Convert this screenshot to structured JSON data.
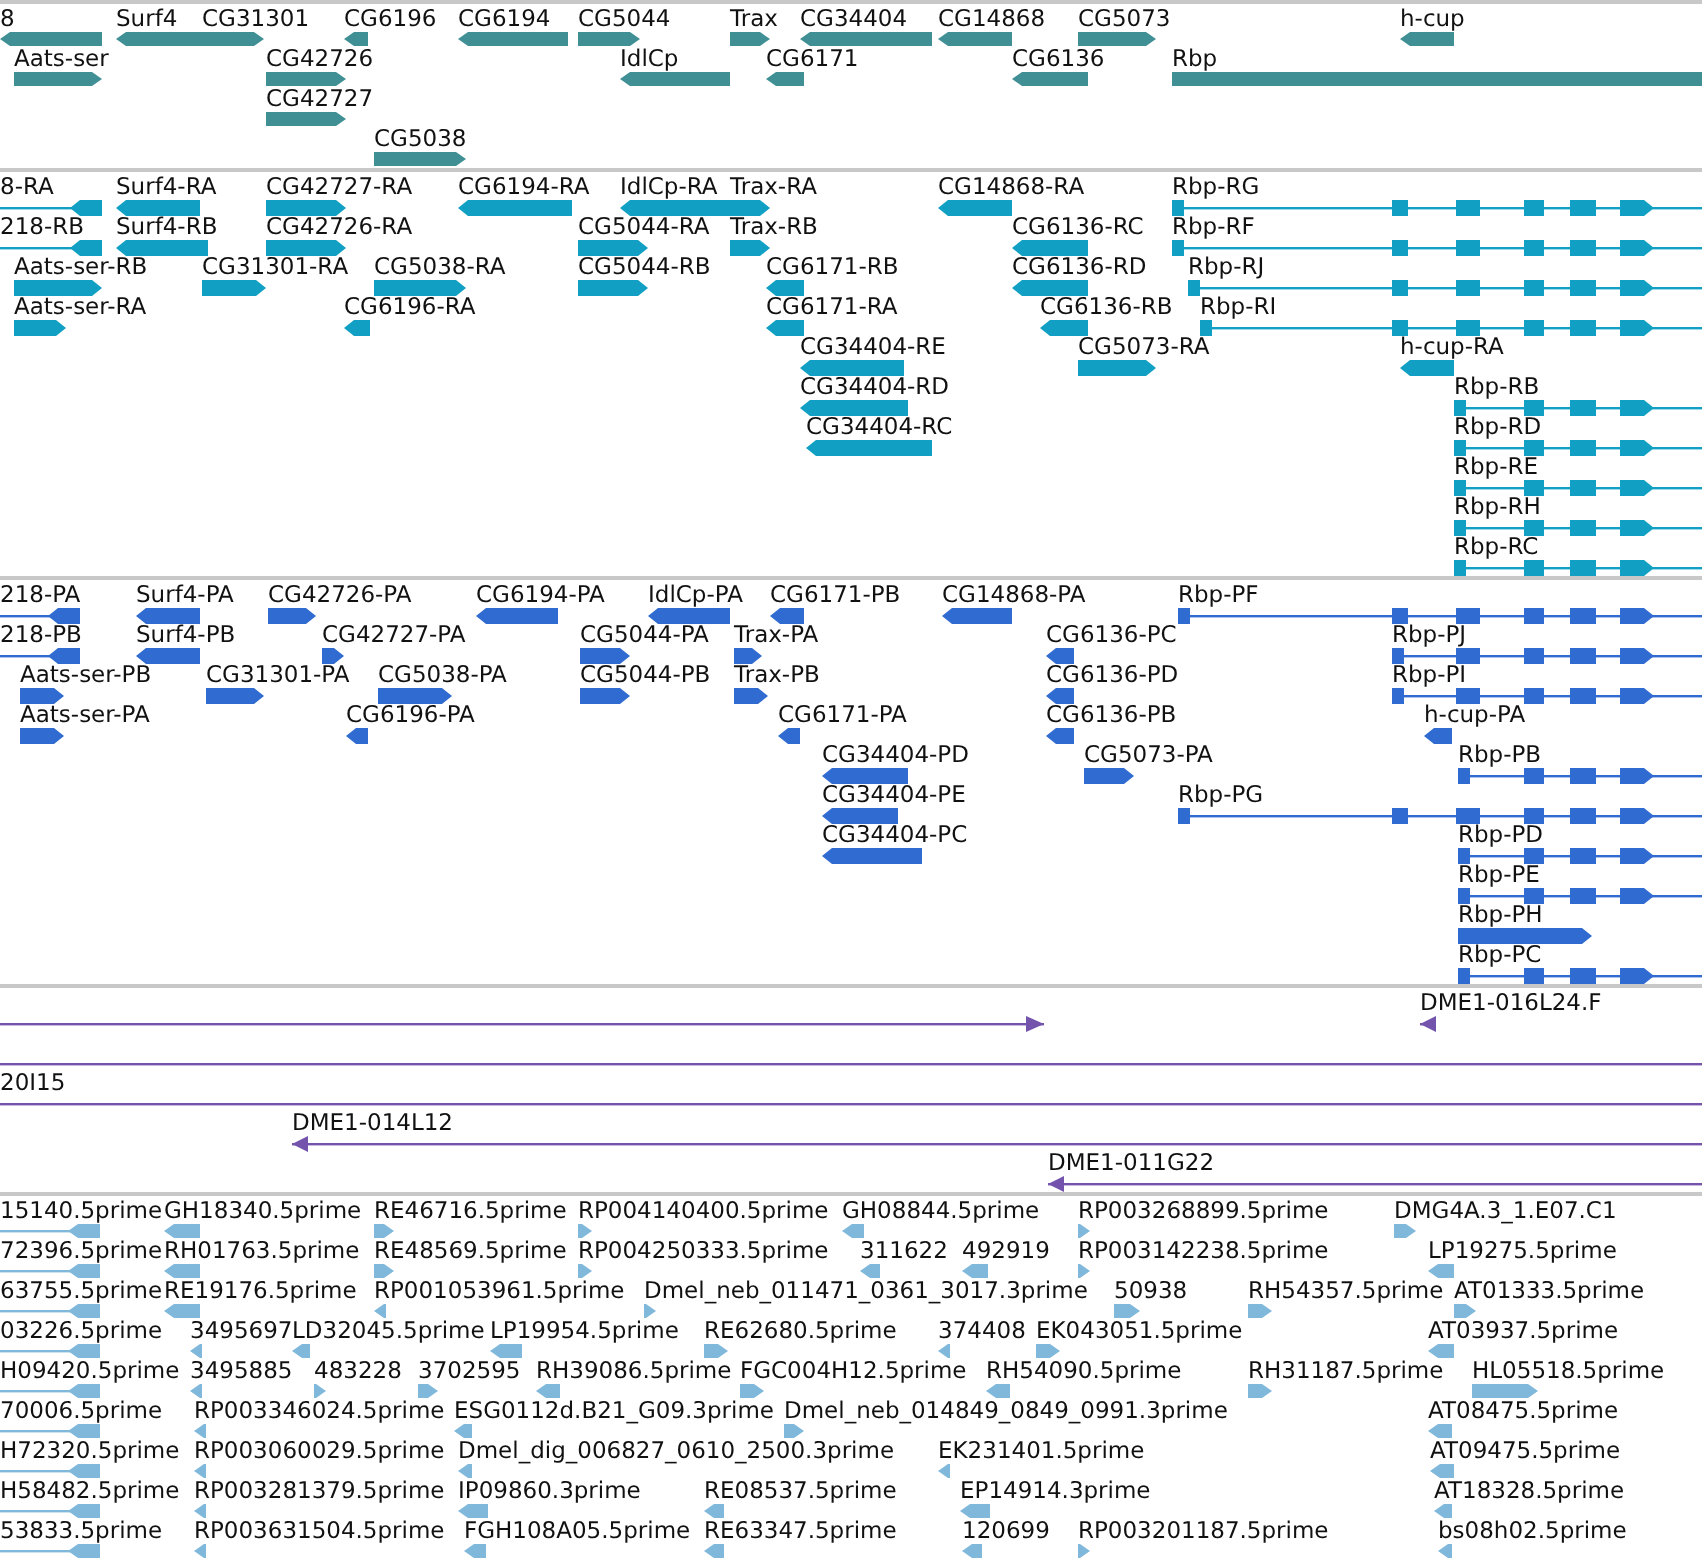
{
  "tracks": [
    {
      "kind": "gene",
      "lanes": [
        {
          "features": [
            {
              "label": "8",
              "kind": "reverse"
            },
            {
              "label": "Surf4",
              "kind": "reverse"
            },
            {
              "label": "CG31301",
              "kind": "forward"
            },
            {
              "label": "CG6196",
              "kind": "reverse"
            },
            {
              "label": "CG6194",
              "kind": "reverse"
            },
            {
              "label": "CG5044",
              "kind": "forward"
            },
            {
              "label": "Trax",
              "kind": "forward"
            },
            {
              "label": "CG34404",
              "kind": "reverse"
            },
            {
              "label": "CG14868",
              "kind": "reverse"
            },
            {
              "label": "CG5073",
              "kind": "forward"
            },
            {
              "label": "h-cup",
              "kind": "reverse"
            }
          ]
        },
        {
          "features": [
            {
              "label": "Aats-ser",
              "kind": "forward"
            },
            {
              "label": "CG42726",
              "kind": "forward"
            },
            {
              "label": "IdlCp",
              "kind": "reverse"
            },
            {
              "label": "CG6171",
              "kind": "reverse"
            },
            {
              "label": "CG6136",
              "kind": "reverse"
            },
            {
              "label": "Rbp"
            }
          ]
        },
        {
          "features": [
            {
              "label": "CG42727",
              "kind": "forward"
            }
          ]
        },
        {
          "features": [
            {
              "label": "CG5038",
              "kind": "forward"
            }
          ]
        }
      ]
    },
    {
      "kind": "transcript",
      "lanes": [
        {
          "features": [
            {
              "label": "8-RA",
              "kind": "reverse"
            },
            {
              "label": "Surf4-RA",
              "kind": "reverse"
            },
            {
              "label": "CG42727-RA",
              "kind": "forward"
            },
            {
              "label": "CG6194-RA",
              "kind": "reverse"
            },
            {
              "label": "IdlCp-RA",
              "kind": "reverse"
            },
            {
              "label": "Trax-RA",
              "kind": "forward"
            },
            {
              "label": "CG14868-RA",
              "kind": "reverse"
            },
            {
              "label": "Rbp-RG",
              "kind": "forward"
            }
          ]
        },
        {
          "features": [
            {
              "label": "218-RB",
              "kind": "reverse"
            },
            {
              "label": "Surf4-RB",
              "kind": "reverse"
            },
            {
              "label": "CG42726-RA",
              "kind": "forward"
            },
            {
              "label": "CG5044-RA",
              "kind": "forward"
            },
            {
              "label": "Trax-RB",
              "kind": "forward"
            },
            {
              "label": "CG6136-RC",
              "kind": "reverse"
            },
            {
              "label": "Rbp-RF",
              "kind": "forward"
            }
          ]
        },
        {
          "features": [
            {
              "label": "Aats-ser-RB",
              "kind": "forward"
            },
            {
              "label": "CG31301-RA",
              "kind": "forward"
            },
            {
              "label": "CG5038-RA",
              "kind": "forward"
            },
            {
              "label": "CG5044-RB",
              "kind": "forward"
            },
            {
              "label": "CG6171-RB",
              "kind": "reverse"
            },
            {
              "label": "CG6136-RD",
              "kind": "reverse"
            },
            {
              "label": "Rbp-RJ",
              "kind": "forward"
            }
          ]
        },
        {
          "features": [
            {
              "label": "Aats-ser-RA",
              "kind": "forward"
            },
            {
              "label": "CG6196-RA",
              "kind": "reverse"
            },
            {
              "label": "CG6171-RA",
              "kind": "reverse"
            },
            {
              "label": "CG6136-RB",
              "kind": "reverse"
            },
            {
              "label": "Rbp-RI",
              "kind": "forward"
            }
          ]
        },
        {
          "features": [
            {
              "label": "CG34404-RE",
              "kind": "reverse"
            },
            {
              "label": "CG5073-RA",
              "kind": "forward"
            },
            {
              "label": "h-cup-RA",
              "kind": "reverse"
            }
          ]
        },
        {
          "features": [
            {
              "label": "CG34404-RD",
              "kind": "reverse"
            },
            {
              "label": "Rbp-RB",
              "kind": "forward"
            }
          ]
        },
        {
          "features": [
            {
              "label": "CG34404-RC",
              "kind": "reverse"
            },
            {
              "label": "Rbp-RD",
              "kind": "forward"
            }
          ]
        },
        {
          "features": [
            {
              "label": "Rbp-RE",
              "kind": "forward"
            }
          ]
        },
        {
          "features": [
            {
              "label": "Rbp-RH",
              "kind": "forward"
            }
          ]
        },
        {
          "features": [
            {
              "label": "Rbp-RC",
              "kind": "forward"
            }
          ]
        }
      ]
    },
    {
      "kind": "protein",
      "lanes": [
        {
          "features": [
            {
              "label": "218-PA",
              "kind": "reverse"
            },
            {
              "label": "Surf4-PA",
              "kind": "reverse"
            },
            {
              "label": "CG42726-PA",
              "kind": "forward"
            },
            {
              "label": "CG6194-PA",
              "kind": "reverse"
            },
            {
              "label": "IdlCp-PA",
              "kind": "reverse"
            },
            {
              "label": "CG6171-PB",
              "kind": "reverse"
            },
            {
              "label": "CG14868-PA",
              "kind": "reverse"
            },
            {
              "label": "Rbp-PF",
              "kind": "forward"
            }
          ]
        },
        {
          "features": [
            {
              "label": "218-PB",
              "kind": "reverse"
            },
            {
              "label": "Surf4-PB",
              "kind": "reverse"
            },
            {
              "label": "CG42727-PA",
              "kind": "forward"
            },
            {
              "label": "CG5044-PA",
              "kind": "forward"
            },
            {
              "label": "Trax-PA",
              "kind": "forward"
            },
            {
              "label": "CG6136-PC",
              "kind": "reverse"
            },
            {
              "label": "Rbp-PJ",
              "kind": "forward"
            }
          ]
        },
        {
          "features": [
            {
              "label": "Aats-ser-PB",
              "kind": "forward"
            },
            {
              "label": "CG31301-PA",
              "kind": "forward"
            },
            {
              "label": "CG5038-PA",
              "kind": "forward"
            },
            {
              "label": "CG5044-PB",
              "kind": "forward"
            },
            {
              "label": "Trax-PB",
              "kind": "forward"
            },
            {
              "label": "CG6136-PD",
              "kind": "reverse"
            },
            {
              "label": "Rbp-PI",
              "kind": "forward"
            }
          ]
        },
        {
          "features": [
            {
              "label": "Aats-ser-PA",
              "kind": "forward"
            },
            {
              "label": "CG6196-PA",
              "kind": "reverse"
            },
            {
              "label": "CG6171-PA",
              "kind": "reverse"
            },
            {
              "label": "CG6136-PB",
              "kind": "reverse"
            },
            {
              "label": "h-cup-PA",
              "kind": "reverse"
            }
          ]
        },
        {
          "features": [
            {
              "label": "CG34404-PD",
              "kind": "reverse"
            },
            {
              "label": "CG5073-PA",
              "kind": "forward"
            },
            {
              "label": "Rbp-PB",
              "kind": "forward"
            }
          ]
        },
        {
          "features": [
            {
              "label": "CG34404-PE",
              "kind": "reverse"
            },
            {
              "label": "Rbp-PG",
              "kind": "forward"
            }
          ]
        },
        {
          "features": [
            {
              "label": "CG34404-PC",
              "kind": "reverse"
            },
            {
              "label": "Rbp-PD",
              "kind": "forward"
            }
          ]
        },
        {
          "features": [
            {
              "label": "Rbp-PE",
              "kind": "forward"
            }
          ]
        },
        {
          "features": [
            {
              "label": "Rbp-PH",
              "kind": "forward"
            }
          ]
        },
        {
          "features": [
            {
              "label": "Rbp-PC",
              "kind": "forward"
            }
          ]
        }
      ]
    },
    {
      "kind": "clone",
      "lanes": [
        {
          "features": [
            {
              "kind": "forward"
            },
            {
              "label": "DME1-016L24.F",
              "kind": "reverse"
            }
          ]
        },
        {
          "features": [
            {
              "kind": "line"
            }
          ]
        },
        {
          "features": [
            {
              "label": "20I15"
            }
          ]
        },
        {
          "features": [
            {
              "label": "DME1-014L12",
              "kind": "reverse"
            }
          ]
        },
        {
          "features": [
            {
              "label": "DME1-011G22",
              "kind": "reverse"
            }
          ]
        }
      ]
    },
    {
      "kind": "est",
      "lanes": [
        {
          "features": [
            {
              "label": "15140.5prime",
              "kind": "reverse"
            },
            {
              "label": "GH18340.5prime",
              "kind": "reverse"
            },
            {
              "label": "RE46716.5prime",
              "kind": "forward"
            },
            {
              "label": "RP004140400.5prime",
              "kind": "forward"
            },
            {
              "label": "GH08844.5prime",
              "kind": "reverse"
            },
            {
              "label": "RP003268899.5prime",
              "kind": "forward"
            },
            {
              "label": "DMG4A.3_1.E07.C1",
              "kind": "forward"
            }
          ]
        },
        {
          "features": [
            {
              "label": "72396.5prime",
              "kind": "reverse"
            },
            {
              "label": "RH01763.5prime",
              "kind": "reverse"
            },
            {
              "label": "RE48569.5prime",
              "kind": "forward"
            },
            {
              "label": "RP004250333.5prime",
              "kind": "forward"
            },
            {
              "label": "311622",
              "kind": "reverse"
            },
            {
              "label": "492919",
              "kind": "reverse"
            },
            {
              "label": "RP003142238.5prime",
              "kind": "forward"
            },
            {
              "label": "LP19275.5prime",
              "kind": "reverse"
            }
          ]
        },
        {
          "features": [
            {
              "label": "63755.5prime",
              "kind": "reverse"
            },
            {
              "label": "RE19176.5prime",
              "kind": "reverse"
            },
            {
              "label": "RP001053961.5prime",
              "kind": "reverse"
            },
            {
              "label": "Dmel_neb_011471_0361_3017.3prime",
              "kind": "forward"
            },
            {
              "label": "50938",
              "kind": "forward"
            },
            {
              "label": "RH54357.5prime",
              "kind": "forward"
            },
            {
              "label": "AT01333.5prime",
              "kind": "forward"
            }
          ]
        },
        {
          "features": [
            {
              "label": "03226.5prime",
              "kind": "reverse"
            },
            {
              "label": "3495697",
              "kind": "reverse"
            },
            {
              "label": "LD32045.5prime",
              "kind": "reverse"
            },
            {
              "label": "LP19954.5prime",
              "kind": "reverse"
            },
            {
              "label": "RE62680.5prime",
              "kind": "forward"
            },
            {
              "label": "374408",
              "kind": "reverse"
            },
            {
              "label": "EK043051.5prime",
              "kind": "forward"
            },
            {
              "label": "AT03937.5prime",
              "kind": "reverse"
            }
          ]
        },
        {
          "features": [
            {
              "label": "H09420.5prime",
              "kind": "reverse"
            },
            {
              "label": "3495885",
              "kind": "reverse"
            },
            {
              "label": "483228",
              "kind": "forward"
            },
            {
              "label": "3702595",
              "kind": "forward"
            },
            {
              "label": "RH39086.5prime",
              "kind": "reverse"
            },
            {
              "label": "FGC004H12.5prime",
              "kind": "forward"
            },
            {
              "label": "RH54090.5prime",
              "kind": "reverse"
            },
            {
              "label": "RH31187.5prime",
              "kind": "forward"
            },
            {
              "label": "HL05518.5prime",
              "kind": "forward"
            }
          ]
        },
        {
          "features": [
            {
              "label": "70006.5prime",
              "kind": "reverse"
            },
            {
              "label": "RP003346024.5prime",
              "kind": "reverse"
            },
            {
              "label": "ESG0112d.B21_G09.3prime",
              "kind": "reverse"
            },
            {
              "label": "Dmel_neb_014849_0849_0991.3prime",
              "kind": "forward"
            },
            {
              "label": "AT08475.5prime",
              "kind": "reverse"
            }
          ]
        },
        {
          "features": [
            {
              "label": "H72320.5prime",
              "kind": "reverse"
            },
            {
              "label": "RP003060029.5prime",
              "kind": "reverse"
            },
            {
              "label": "Dmel_dig_006827_0610_2500.3prime",
              "kind": "reverse"
            },
            {
              "label": "EK231401.5prime",
              "kind": "reverse"
            },
            {
              "label": "AT09475.5prime",
              "kind": "reverse"
            }
          ]
        },
        {
          "features": [
            {
              "label": "H58482.5prime",
              "kind": "reverse"
            },
            {
              "label": "RP003281379.5prime",
              "kind": "reverse"
            },
            {
              "label": "IP09860.3prime",
              "kind": "reverse"
            },
            {
              "label": "RE08537.5prime",
              "kind": "reverse"
            },
            {
              "label": "EP14914.3prime",
              "kind": "reverse"
            },
            {
              "label": "AT18328.5prime",
              "kind": "reverse"
            }
          ]
        },
        {
          "features": [
            {
              "label": "53833.5prime",
              "kind": "reverse"
            },
            {
              "label": "RP003631504.5prime",
              "kind": "reverse"
            },
            {
              "label": "FGH108A05.5prime",
              "kind": "reverse"
            },
            {
              "label": "RE63347.5prime",
              "kind": "reverse"
            },
            {
              "label": "120699",
              "kind": "reverse"
            },
            {
              "label": "RP003201187.5prime",
              "kind": "forward"
            },
            {
              "label": "bs08h02.5prime",
              "kind": "reverse"
            }
          ]
        }
      ]
    }
  ]
}
